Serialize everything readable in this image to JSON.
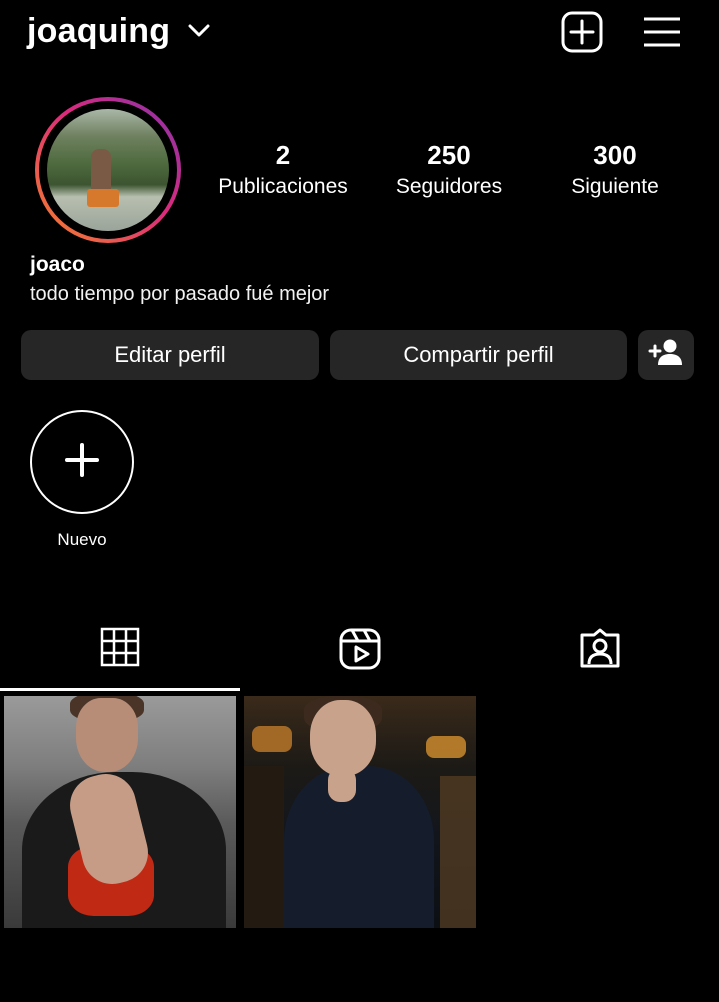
{
  "header": {
    "username": "joaquing",
    "icons": [
      "chevron-down-icon",
      "plus-square-icon",
      "hamburger-menu-icon"
    ]
  },
  "profile": {
    "stats": [
      {
        "value": "2",
        "label": "Publicaciones"
      },
      {
        "value": "250",
        "label": "Seguidores"
      },
      {
        "value": "300",
        "label": "Siguiente"
      }
    ],
    "display_name": "joaco",
    "bio": "todo tiempo por pasado fué mejor"
  },
  "actions": {
    "edit_label": "Editar perfil",
    "share_label": "Compartir perfil",
    "add_person_icon": "add-person-icon"
  },
  "highlights": [
    {
      "label": "Nuevo",
      "icon": "plus-icon"
    }
  ],
  "tabs": [
    {
      "name": "grid",
      "icon": "grid-icon",
      "active": true
    },
    {
      "name": "reels",
      "icon": "reels-icon",
      "active": false
    },
    {
      "name": "tagged",
      "icon": "tagged-person-icon",
      "active": false
    }
  ],
  "posts_count_shown": 2,
  "colors": {
    "background": "#000000",
    "button_bg": "#262626",
    "ring_start": "#f58529",
    "ring_mid": "#dd2a7b",
    "ring_end": "#8134af"
  }
}
